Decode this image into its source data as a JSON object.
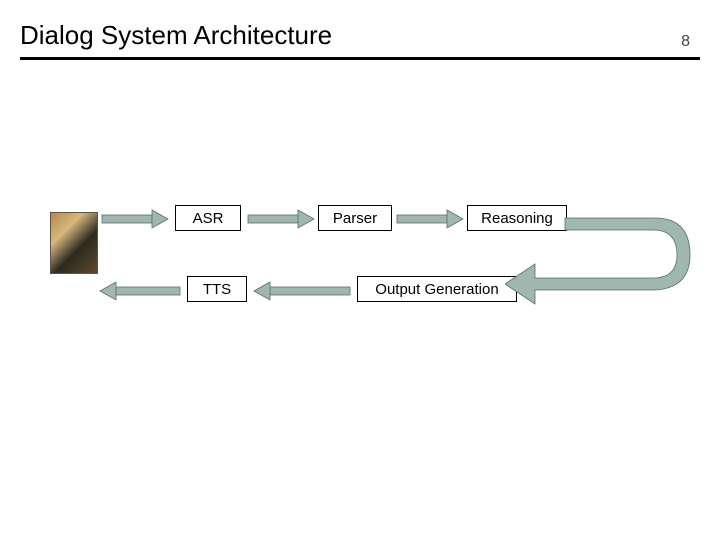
{
  "header": {
    "title": "Dialog System Architecture",
    "page_number": "8"
  },
  "nodes": {
    "asr": "ASR",
    "parser": "Parser",
    "reasoning": "Reasoning",
    "tts": "TTS",
    "output_gen": "Output Generation"
  },
  "arrows": {
    "color": "#9fb7b0",
    "stroke": "#5a6e68"
  }
}
